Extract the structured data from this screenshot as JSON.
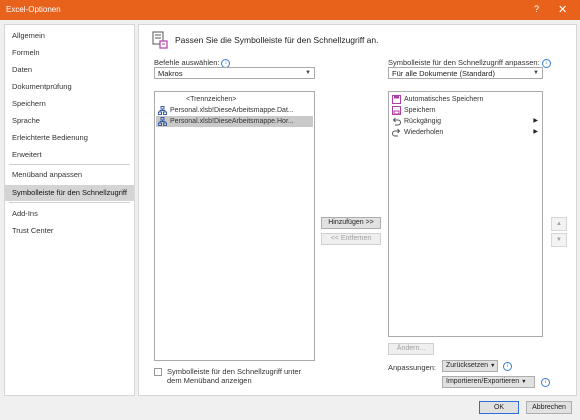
{
  "window": {
    "title": "Excel-Optionen",
    "help_glyph": "?",
    "close_glyph": "✕"
  },
  "sidebar": {
    "items": [
      {
        "label": "Allgemein"
      },
      {
        "label": "Formeln"
      },
      {
        "label": "Daten"
      },
      {
        "label": "Dokumentprüfung"
      },
      {
        "label": "Speichern"
      },
      {
        "label": "Sprache"
      },
      {
        "label": "Erleichterte Bedienung"
      },
      {
        "label": "Erweitert"
      },
      {
        "label": "Menüband anpassen"
      },
      {
        "label": "Symbolleiste für den Schnellzugriff",
        "active": true
      },
      {
        "label": "Add-Ins"
      },
      {
        "label": "Trust Center"
      }
    ]
  },
  "main": {
    "heading": "Passen Sie die Symbolleiste für den Schnellzugriff an.",
    "choose_label": "Befehle auswählen:",
    "choose_value": "Makros",
    "left_list": [
      {
        "label": "<Trennzeichen>",
        "icon": "separator"
      },
      {
        "label": "Personal.xlsb!DieseArbeitsmappe.Dat...",
        "icon": "macro-icon"
      },
      {
        "label": "Personal.xlsb!DieseArbeitsmappe.Hor...",
        "icon": "macro-icon",
        "selected": true
      }
    ],
    "customize_label": "Symbolleiste für den Schnellzugriff anpassen:",
    "customize_value": "Für alle Dokumente (Standard)",
    "right_list": [
      {
        "label": "Automatisches Speichern",
        "icon": "autosave-icon"
      },
      {
        "label": "Speichern",
        "icon": "save-icon"
      },
      {
        "label": "Rückgängig",
        "icon": "undo-icon",
        "submenu": true
      },
      {
        "label": "Wiederholen",
        "icon": "redo-icon",
        "submenu": true
      }
    ],
    "add_button": "Hinzufügen >>",
    "remove_button": "<< Entfernen",
    "modify_button": "Ändern...",
    "show_below_label_line1": "Symbolleiste für den Schnellzugriff unter",
    "show_below_label_line2": "dem Menüband anzeigen",
    "customizations_label": "Anpassungen:",
    "reset_button": "Zurücksetzen",
    "import_export_button": "Importieren/Exportieren"
  },
  "footer": {
    "ok": "OK",
    "cancel": "Abbrechen"
  },
  "colors": {
    "accent": "#e8621c",
    "primary_border": "#2b6fd6",
    "icon_purple": "#b03fa7"
  }
}
